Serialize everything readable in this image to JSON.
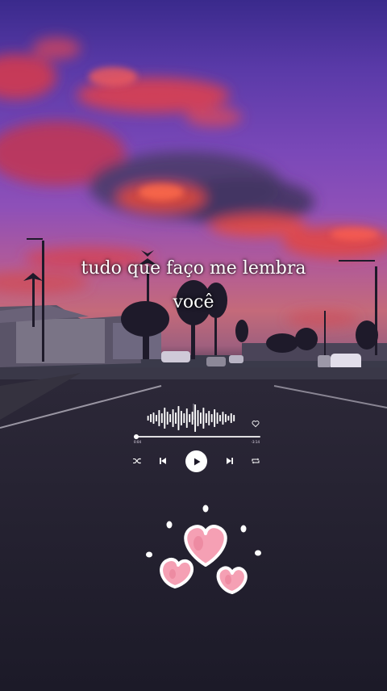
{
  "lyrics": {
    "line1": "tudo que faço me lembra",
    "line2": "você"
  },
  "player": {
    "elapsed_time": "0:04",
    "remaining_time": "-3:14",
    "progress": 0.02,
    "liked": false
  },
  "icons": {
    "waveform": "waveform-icon",
    "like": "heart-outline-icon",
    "shuffle": "shuffle-icon",
    "previous": "skip-previous-icon",
    "play": "play-icon",
    "next": "skip-next-icon",
    "repeat": "repeat-icon",
    "decoration": "hearts-sticker-icon"
  },
  "colors": {
    "sky_top": "#3a2a8c",
    "sky_glow": "#c46a7a",
    "clouds": "#e8404a",
    "controls": "#ffffff",
    "hearts": "#f7a3b4"
  }
}
